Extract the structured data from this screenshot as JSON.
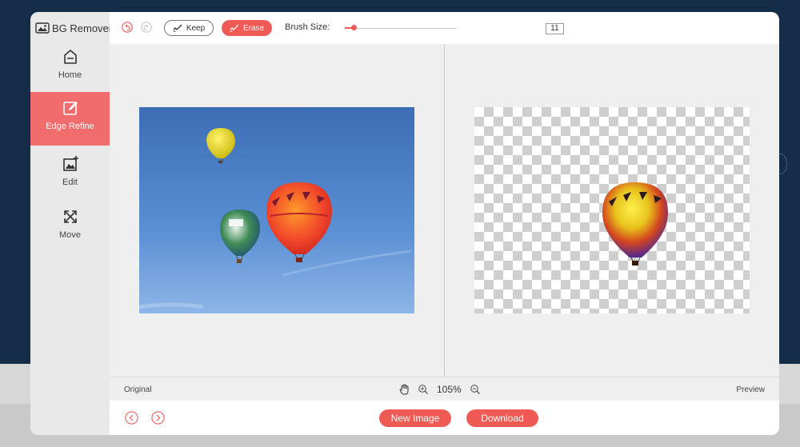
{
  "app": {
    "title": "BG Remover"
  },
  "sidebar": {
    "items": [
      {
        "label": "Home",
        "icon": "home-icon",
        "active": false
      },
      {
        "label": "Edge Refine",
        "icon": "edge-refine-icon",
        "active": true
      },
      {
        "label": "Edit",
        "icon": "image-edit-icon",
        "active": false
      },
      {
        "label": "Move",
        "icon": "move-arrows-icon",
        "active": false
      }
    ]
  },
  "toolbar": {
    "undo_icon": "undo-icon",
    "redo_icon": "redo-icon",
    "keep_label": "Keep",
    "erase_label": "Erase",
    "brush_label": "Brush Size:",
    "brush_value": "11",
    "brush_fraction": 0.08
  },
  "status": {
    "original_label": "Original",
    "preview_label": "Preview",
    "zoom": "105%"
  },
  "bottom": {
    "new_image_label": "New Image",
    "download_label": "Download"
  },
  "colors": {
    "accent": "#f05a55",
    "sidebar_active": "#f16c6c",
    "page_background": "#152c48"
  }
}
